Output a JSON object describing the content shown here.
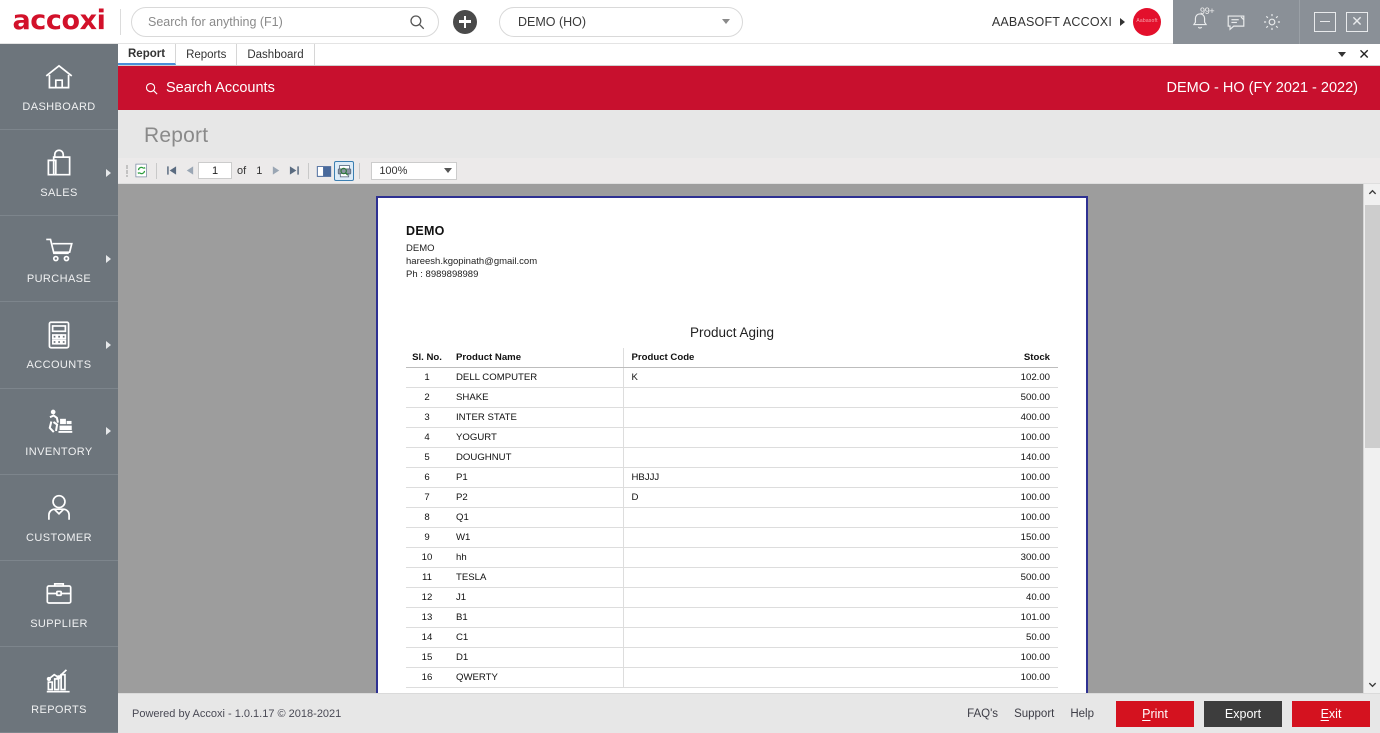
{
  "brand": {
    "name": "accoxi"
  },
  "search": {
    "placeholder": "Search for anything (F1)",
    "value": "",
    "icon": "search-icon"
  },
  "add_button": {
    "icon": "plus-icon",
    "label": ""
  },
  "branch": {
    "selected": "DEMO (HO)"
  },
  "user": {
    "name": "AABASOFT ACCOXI",
    "avatar_text": "Aabasoft"
  },
  "system_icons": [
    {
      "name": "bell-icon",
      "badge": "99+"
    },
    {
      "name": "message-icon",
      "badge": ""
    },
    {
      "name": "gear-icon",
      "badge": ""
    }
  ],
  "window_controls": [
    {
      "name": "minimize-button",
      "glyph": "−"
    },
    {
      "name": "close-button",
      "glyph": "✕"
    }
  ],
  "sidebar": {
    "items": [
      {
        "label": "DASHBOARD",
        "icon": "home-icon",
        "has_arrow": false
      },
      {
        "label": "SALES",
        "icon": "shopping-bag-icon",
        "has_arrow": true
      },
      {
        "label": "PURCHASE",
        "icon": "shopping-cart-icon",
        "has_arrow": true
      },
      {
        "label": "ACCOUNTS",
        "icon": "calculator-icon",
        "has_arrow": true
      },
      {
        "label": "INVENTORY",
        "icon": "warehouse-worker-icon",
        "has_arrow": true
      },
      {
        "label": "CUSTOMER",
        "icon": "person-icon",
        "has_arrow": false
      },
      {
        "label": "SUPPLIER",
        "icon": "briefcase-icon",
        "has_arrow": false
      },
      {
        "label": "REPORTS",
        "icon": "bar-chart-icon",
        "has_arrow": false
      }
    ]
  },
  "tabs": {
    "items": [
      {
        "label": "Report",
        "active": true
      },
      {
        "label": "Reports",
        "active": false
      },
      {
        "label": "Dashboard",
        "active": false
      }
    ],
    "dropdown_icon": "chevron-down-icon",
    "close_icon": "close-icon"
  },
  "red_bar": {
    "search_label": "Search Accounts",
    "search_icon": "search-icon",
    "context": "DEMO - HO (FY 2021 - 2022)"
  },
  "page": {
    "title": "Report"
  },
  "report_toolbar": {
    "refresh_icon": "refresh-icon",
    "first_page_icon": "first-page-icon",
    "prev_page_icon": "previous-page-icon",
    "current_page": "1",
    "of_label": "of",
    "total_pages": "1",
    "next_page_icon": "next-page-icon",
    "last_page_icon": "last-page-icon",
    "book_icon": "book-icon",
    "print_preview_icon": "print-preview-icon",
    "zoom_value": "100%",
    "zoom_caret_icon": "chevron-down-icon"
  },
  "report": {
    "company_name": "DEMO",
    "lines": [
      "DEMO",
      "hareesh.kgopinath@gmail.com",
      "Ph : 8989898989"
    ],
    "title": "Product Aging",
    "columns": [
      "Sl. No.",
      "Product Name",
      "Product Code",
      "Stock"
    ],
    "rows": [
      {
        "sl": "1",
        "name": "DELL COMPUTER",
        "code": "K",
        "stock": "102.00"
      },
      {
        "sl": "2",
        "name": "SHAKE",
        "code": "",
        "stock": "500.00"
      },
      {
        "sl": "3",
        "name": "INTER STATE",
        "code": "",
        "stock": "400.00"
      },
      {
        "sl": "4",
        "name": "YOGURT",
        "code": "",
        "stock": "100.00"
      },
      {
        "sl": "5",
        "name": "DOUGHNUT",
        "code": "",
        "stock": "140.00"
      },
      {
        "sl": "6",
        "name": "P1",
        "code": "HBJJJ",
        "stock": "100.00"
      },
      {
        "sl": "7",
        "name": "P2",
        "code": "D",
        "stock": "100.00"
      },
      {
        "sl": "8",
        "name": "Q1",
        "code": "",
        "stock": "100.00"
      },
      {
        "sl": "9",
        "name": "W1",
        "code": "",
        "stock": "150.00"
      },
      {
        "sl": "10",
        "name": "hh",
        "code": "",
        "stock": "300.00"
      },
      {
        "sl": "11",
        "name": "TESLA",
        "code": "",
        "stock": "500.00"
      },
      {
        "sl": "12",
        "name": "J1",
        "code": "",
        "stock": "40.00"
      },
      {
        "sl": "13",
        "name": "B1",
        "code": "",
        "stock": "101.00"
      },
      {
        "sl": "14",
        "name": "C1",
        "code": "",
        "stock": "50.00"
      },
      {
        "sl": "15",
        "name": "D1",
        "code": "",
        "stock": "100.00"
      },
      {
        "sl": "16",
        "name": "QWERTY",
        "code": "",
        "stock": "100.00"
      }
    ]
  },
  "scrollbar": {
    "up_icon": "chevron-up-icon",
    "down_icon": "chevron-down-icon"
  },
  "footer": {
    "powered_by": "Powered by Accoxi - 1.0.1.17 © 2018-2021",
    "links": [
      "FAQ's",
      "Support",
      "Help"
    ],
    "buttons": [
      {
        "label": "Print",
        "style": "red"
      },
      {
        "label": "Export",
        "style": "dark"
      },
      {
        "label": "Exit",
        "style": "red"
      }
    ]
  },
  "colors": {
    "brand_red": "#d2112a",
    "bar_red": "#c8102e",
    "sidebar_gray": "#6d757c",
    "sysbar_gray": "#8a9097",
    "viewer_gray": "#9d9d9d",
    "paper_border": "#2e3192"
  }
}
